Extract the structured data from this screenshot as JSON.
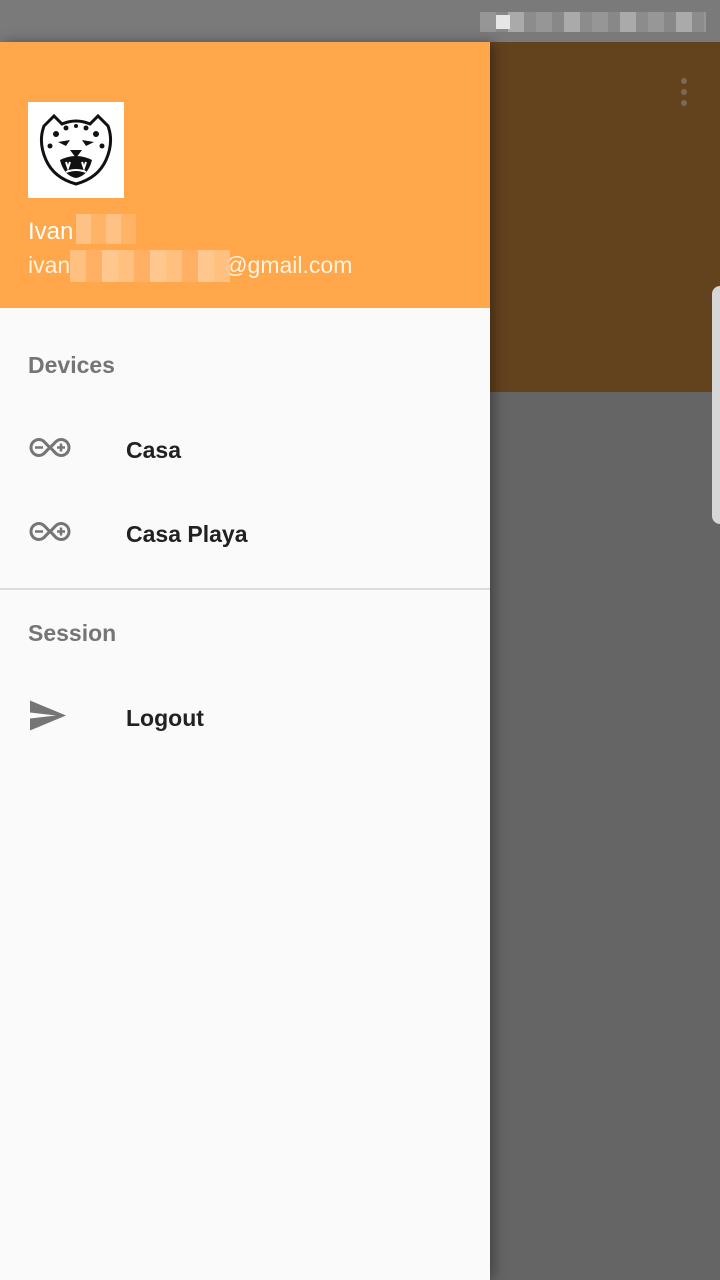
{
  "status_bar": {
    "indicator_icon": "status-indicator-icon"
  },
  "app": {
    "toolbar_color": "#63421e",
    "overflow_icon": "more-vertical-icon"
  },
  "drawer": {
    "header": {
      "background_color": "#ffa74a",
      "avatar_icon": "leopard-avatar-icon",
      "user_name": "Ivan",
      "user_email_prefix": "ivan",
      "user_email_suffix": "@gmail.com"
    },
    "sections": [
      {
        "title": "Devices",
        "items": [
          {
            "label": "Casa",
            "icon": "arduino-icon"
          },
          {
            "label": "Casa Playa",
            "icon": "arduino-icon"
          }
        ]
      },
      {
        "title": "Session",
        "items": [
          {
            "label": "Logout",
            "icon": "send-icon"
          }
        ]
      }
    ]
  }
}
